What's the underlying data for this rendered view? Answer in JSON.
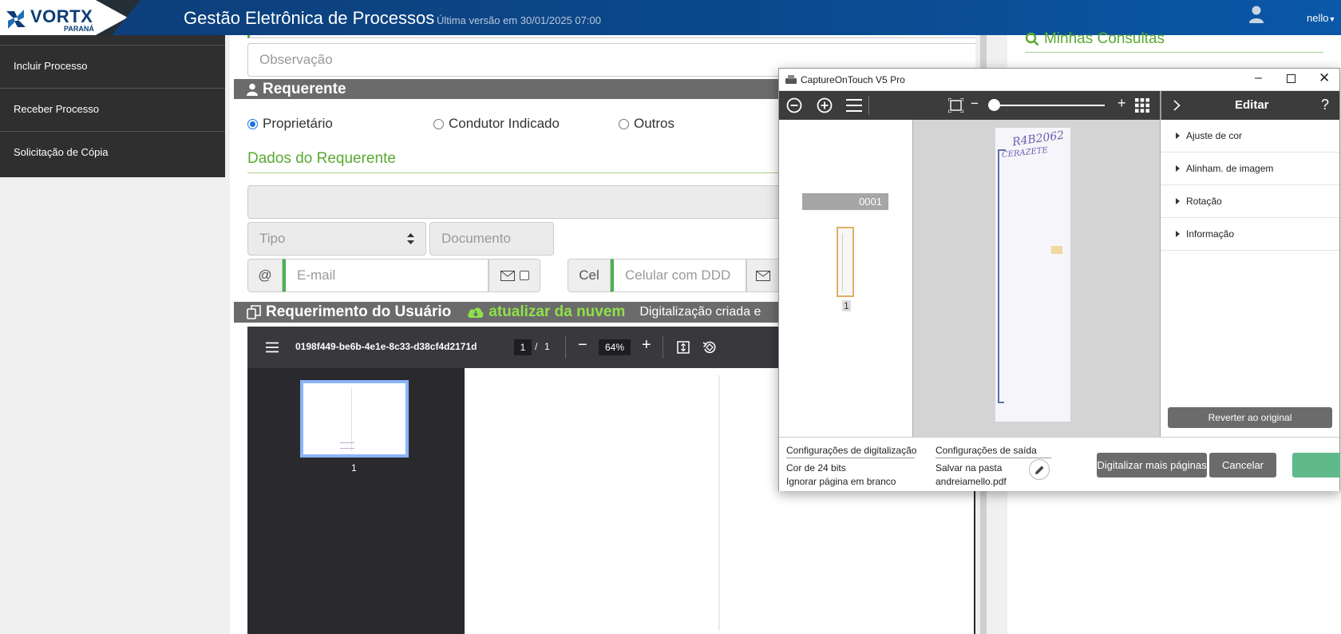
{
  "header": {
    "logo_text": "VORTX",
    "logo_sub": "PARANÁ",
    "title": "Gestão Eletrônica de Processos",
    "version": "Última versão em 30/01/2025 07:00",
    "user_name": "nello"
  },
  "sidebar": {
    "items": [
      {
        "label": "Incluir Processo"
      },
      {
        "label": "Receber Processo"
      },
      {
        "label": "Solicitação de Cópia"
      }
    ]
  },
  "form": {
    "observacao_placeholder": "Observação",
    "requerente_title": "Requerente",
    "radios": [
      {
        "label": "Proprietário",
        "checked": true
      },
      {
        "label": "Condutor Indicado",
        "checked": false
      },
      {
        "label": "Outros",
        "checked": false
      }
    ],
    "dados_title": "Dados do Requerente",
    "tipo_placeholder": "Tipo",
    "documento_placeholder": "Documento",
    "email_addon": "@",
    "email_placeholder": "E-mail",
    "cel_addon": "Cel",
    "cel_placeholder": "Celular com DDD",
    "requerimento_title": "Requerimento do Usuário",
    "cloud_link": "atualizar da nuvem",
    "digitalizacao_text": "Digitalização criada e"
  },
  "pdf": {
    "filename": "0198f449-be6b-4e1e-8c33-d38cf4d2171d",
    "page_current": "1",
    "page_sep": "/",
    "page_total": "1",
    "zoom": "64%",
    "thumb_label": "1"
  },
  "right_panel": {
    "title": "Minhas Consultas"
  },
  "capture": {
    "title": "CaptureOnTouch V5 Pro",
    "edit_title": "Editar",
    "help": "?",
    "batch_label": "0001",
    "thumb_number": "1",
    "preview_handwriting_1": "R4B2062",
    "preview_handwriting_2": "CERAZETE",
    "edit_items": [
      {
        "label": "Ajuste de cor"
      },
      {
        "label": "Alinham. de imagem"
      },
      {
        "label": "Rotação"
      },
      {
        "label": "Informação"
      }
    ],
    "revert_label": "Reverter ao original",
    "scan_settings_title": "Configurações de digitalização",
    "scan_color": "Cor de 24 bits",
    "scan_skip": "Ignorar página em branco",
    "output_settings_title": "Configurações de saída",
    "output_save": "Salvar na pasta",
    "output_file": "andreiamello.pdf",
    "btn_more": "Digitalizar mais páginas",
    "btn_cancel": "Cancelar",
    "zoom_slider_value": 0.0,
    "colors": {
      "toolbar": "#3c3c3c",
      "accent_green": "#5fb98a"
    }
  },
  "colors": {
    "header": "#0b4a8e",
    "sidebar": "#2f2f2f",
    "section_bar": "#6b6b6b",
    "green": "#5aaa32"
  }
}
